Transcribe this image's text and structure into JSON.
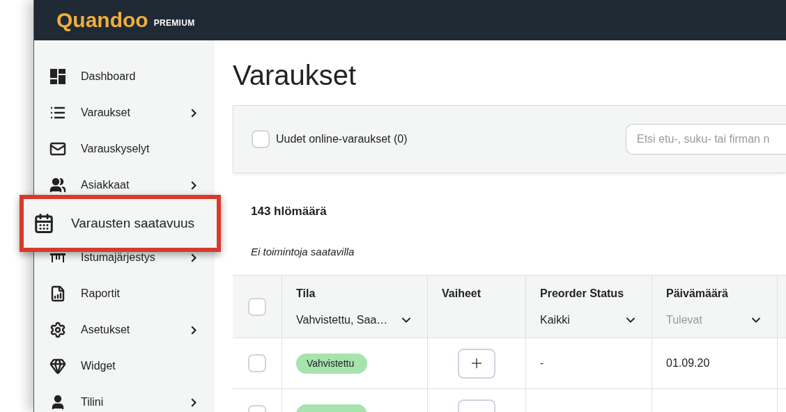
{
  "header": {
    "logo": "Quandoo",
    "tier": "PREMIUM"
  },
  "sidebar": {
    "items": [
      {
        "label": "Dashboard",
        "kind": "dashboard",
        "has_submenu": false,
        "highlighted": false
      },
      {
        "label": "Varaukset",
        "kind": "list",
        "has_submenu": true,
        "highlighted": false
      },
      {
        "label": "Varauskyselyt",
        "kind": "mail",
        "has_submenu": false,
        "highlighted": false
      },
      {
        "label": "Asiakkaat",
        "kind": "people",
        "has_submenu": true,
        "highlighted": false
      },
      {
        "label": "Varausten saatavuus",
        "kind": "calendar",
        "has_submenu": false,
        "highlighted": true
      },
      {
        "label": "Istumajärjestys",
        "kind": "table",
        "has_submenu": true,
        "highlighted": false
      },
      {
        "label": "Raportit",
        "kind": "report",
        "has_submenu": false,
        "highlighted": false
      },
      {
        "label": "Asetukset",
        "kind": "gear",
        "has_submenu": true,
        "highlighted": false
      },
      {
        "label": "Widget",
        "kind": "diamond",
        "has_submenu": false,
        "highlighted": false
      },
      {
        "label": "Tilini",
        "kind": "person",
        "has_submenu": true,
        "highlighted": false
      }
    ]
  },
  "page_title": "Varaukset",
  "filters": {
    "online_checkbox": {
      "label": "Uudet online-varaukset (0)",
      "checked": false
    },
    "search": {
      "placeholder": "Etsi etu-, suku- tai firman n"
    }
  },
  "count": "143 hlömäärä",
  "actions_note": "Ei toimintoja saatavilla",
  "table": {
    "select_all_checked": false,
    "columns": [
      {
        "label": "Tila",
        "filter": "Vahvistettu, Saa…"
      },
      {
        "label": "Vaiheet"
      },
      {
        "label": "Preorder Status",
        "filter": "Kaikki"
      },
      {
        "label": "Päivämäärä",
        "placeholder": "Tulevat"
      }
    ],
    "rows": [
      {
        "checked": false,
        "status": "Vahvistettu",
        "preorder": "-",
        "date": "01.09.20"
      },
      {
        "checked": false
      }
    ]
  }
}
